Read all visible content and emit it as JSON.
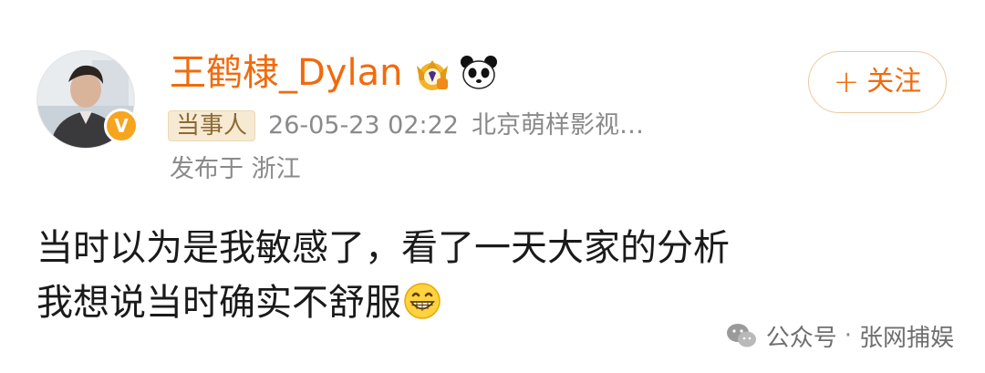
{
  "post": {
    "username": "王鹤棣_Dylan",
    "role_tag": "当事人",
    "timestamp": "26-05-23 02:22",
    "source": "北京萌样影视…",
    "location": "发布于 浙江",
    "follow": {
      "plus": "+",
      "label": "关注"
    },
    "content_lines": [
      "当时以为是我敏感了，看了一天大家的分析",
      "我想说当时确实不舒服"
    ],
    "verified_mark": "V"
  },
  "watermark": {
    "prefix": "公众号",
    "separator": "·",
    "name": "张网捕娱"
  },
  "colors": {
    "username": "#f26a0c",
    "verified": "#f7a51f",
    "meta": "#8a8a8a",
    "tag_bg": "#f7ead2"
  },
  "icons": [
    "crown-badge-icon",
    "panda-icon",
    "grin-emoji-icon",
    "wechat-icon",
    "verified-icon"
  ]
}
